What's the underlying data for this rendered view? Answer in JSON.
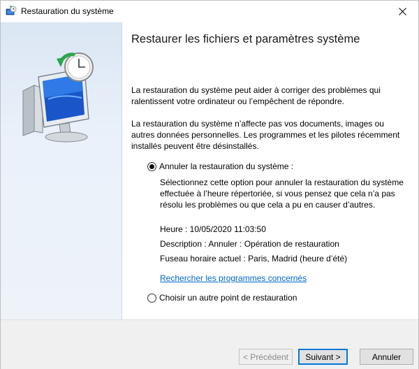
{
  "window": {
    "title": "Restauration du système",
    "icon": "system-restore-icon"
  },
  "content": {
    "heading": "Restaurer les fichiers et paramètres système",
    "para1": "La restauration du système peut aider à corriger des problèmes qui ralentissent votre ordinateur ou l’empêchent de répondre.",
    "para2": "La restauration du système n’affecte pas vos documents, images ou autres données personnelles. Les programmes et les pilotes récemment installés peuvent être désinstallés.",
    "option_undo": {
      "label": "Annuler la restauration du système :",
      "checked": true,
      "description": "Sélectionnez cette option pour annuler la restauration du système effectuée à l’heure répertoriée, si vous pensez que cela n’a pas résolu les problèmes ou que cela a pu en causer d’autres.",
      "time": "Heure : 10/05/2020 11:03:50",
      "desc": "Description : Annuler : Opération de restauration",
      "timezone": "Fuseau horaire actuel : Paris, Madrid (heure d’été)",
      "link": "Rechercher les programmes concernés"
    },
    "option_other": {
      "label": "Choisir un autre point de restauration",
      "checked": false
    }
  },
  "footer": {
    "back_label": "< Précédent",
    "next_label": "Suivant >",
    "cancel_label": "Annuler"
  },
  "colors": {
    "sidebar_top": "#dbe6f4",
    "link": "#0066cc",
    "default_button_border": "#0078d7"
  }
}
